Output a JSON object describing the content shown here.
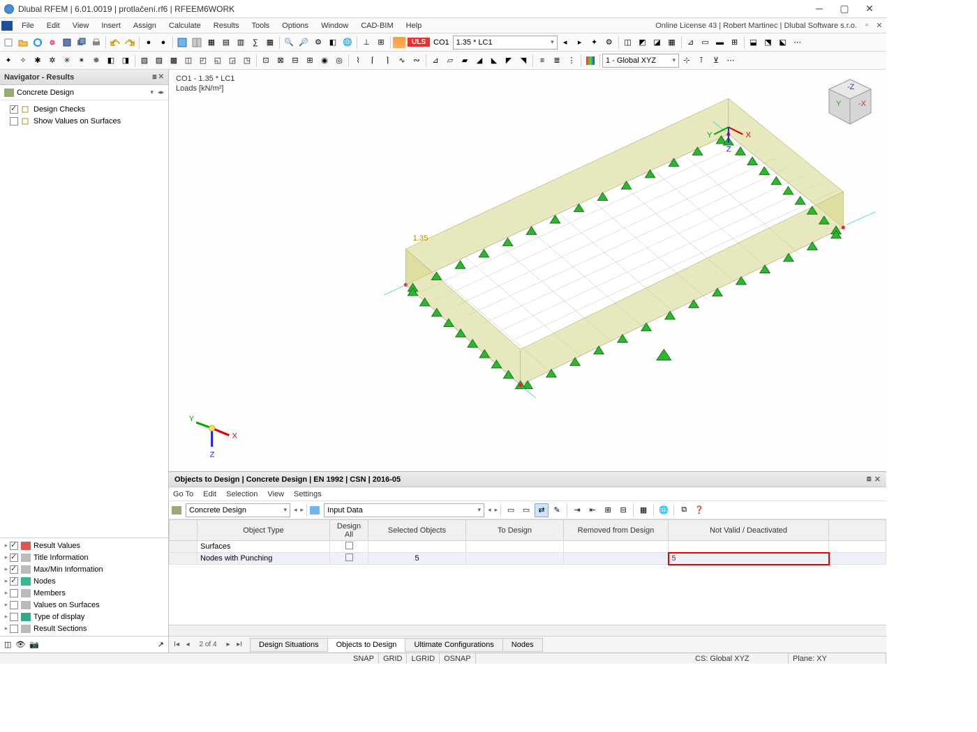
{
  "title": "Dlubal RFEM | 6.01.0019 | protlačení.rf6 | RFEEM6WORK",
  "license_info": "Online License 43 | Robert Martinec | Dlubal Software s.r.o.",
  "menu": [
    "File",
    "Edit",
    "View",
    "Insert",
    "Assign",
    "Calculate",
    "Results",
    "Tools",
    "Options",
    "Window",
    "CAD-BIM",
    "Help"
  ],
  "uls_label": "ULS",
  "loadcase_code": "CO1",
  "loadcase_desc": "1.35 * LC1",
  "coord_system": "1 - Global XYZ",
  "navigator": {
    "title": "Navigator - Results",
    "section": "Concrete Design",
    "items": [
      {
        "label": "Design Checks",
        "checked": true
      },
      {
        "label": "Show Values on Surfaces",
        "checked": false
      }
    ],
    "bottom_items": [
      {
        "label": "Result Values",
        "checked": true,
        "color": "#d55"
      },
      {
        "label": "Title Information",
        "checked": true,
        "color": "#bbb"
      },
      {
        "label": "Max/Min Information",
        "checked": true,
        "color": "#bbb"
      },
      {
        "label": "Nodes",
        "checked": true,
        "color": "#3b8"
      },
      {
        "label": "Members",
        "checked": false,
        "color": "#bbb"
      },
      {
        "label": "Values on Surfaces",
        "checked": false,
        "color": "#bbb"
      },
      {
        "label": "Type of display",
        "checked": false,
        "color": "#3a8"
      },
      {
        "label": "Result Sections",
        "checked": false,
        "color": "#bbb"
      }
    ]
  },
  "viewport": {
    "line1": "CO1 - 1.35 * LC1",
    "line2": "Loads [kN/m²]",
    "label_value": "1.35"
  },
  "bottom": {
    "title": "Objects to Design | Concrete Design | EN 1992 | CSN | 2016-05",
    "menu": [
      "Go To",
      "Edit",
      "Selection",
      "View",
      "Settings"
    ],
    "combo1": "Concrete Design",
    "combo2": "Input Data",
    "columns": [
      "",
      "Object Type",
      "Design All",
      "Selected Objects",
      "To Design",
      "Removed from Design",
      "Not Valid / Deactivated"
    ],
    "rows": [
      {
        "type": "Surfaces",
        "design_all": false,
        "selected": "",
        "to_design": "",
        "removed": "",
        "invalid": ""
      },
      {
        "type": "Nodes with Punching",
        "design_all": false,
        "selected": "5",
        "to_design": "",
        "removed": "",
        "invalid": "5"
      }
    ],
    "pager": "2 of 4",
    "tabs": [
      "Design Situations",
      "Objects to Design",
      "Ultimate Configurations",
      "Nodes"
    ],
    "active_tab": 1
  },
  "status": {
    "snap": "SNAP",
    "grid": "GRID",
    "lgrid": "LGRID",
    "osnap": "OSNAP",
    "cs": "CS: Global XYZ",
    "plane": "Plane: XY"
  }
}
